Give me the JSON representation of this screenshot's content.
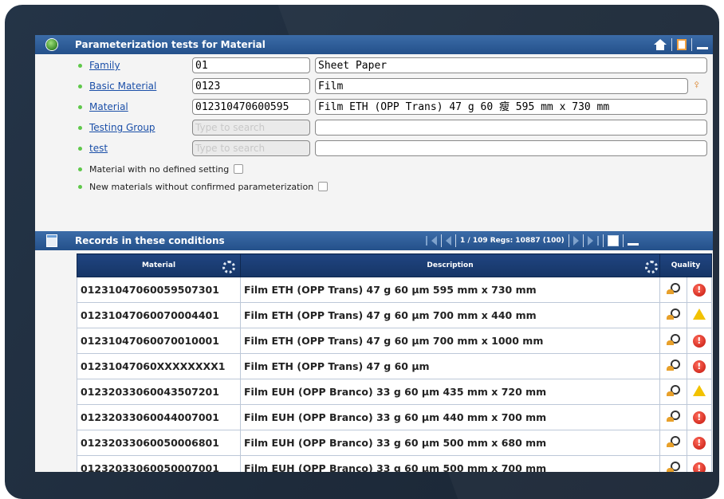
{
  "panel": {
    "title": "Parameterization tests for Material"
  },
  "form": {
    "family": {
      "label": "Family",
      "code": "01",
      "desc": "Sheet Paper"
    },
    "basic_material": {
      "label": "Basic Material",
      "code": "0123",
      "desc": "Film"
    },
    "material": {
      "label": "Material",
      "code": "012310470600595",
      "desc": "Film ETH (OPP Trans) 47 g 60 瘦 595 mm x 730 mm"
    },
    "testing_group": {
      "label": "Testing Group",
      "placeholder": "Type to search",
      "desc": ""
    },
    "test": {
      "label": "test",
      "placeholder": "Type to search",
      "desc": ""
    },
    "no_setting_label": "Material with no defined setting",
    "new_materials_label": "New materials without confirmed parameterization"
  },
  "records": {
    "title": "Records in these conditions",
    "pager_text": "1 / 109  Regs: 10887  (100)",
    "columns": {
      "material": "Material",
      "description": "Description",
      "quality": "Quality"
    },
    "rows": [
      {
        "material": "01231047060059507301",
        "description": "Film ETH (OPP Trans) 47 g 60 μm 595 mm x 730 mm",
        "status": "error"
      },
      {
        "material": "01231047060070004401",
        "description": "Film ETH (OPP Trans) 47 g 60 μm 700 mm x 440 mm",
        "status": "warning"
      },
      {
        "material": "01231047060070010001",
        "description": "Film ETH (OPP Trans) 47 g 60 μm 700 mm x 1000 mm",
        "status": "error"
      },
      {
        "material": "01231047060XXXXXXXX1",
        "description": "Film ETH (OPP Trans) 47 g 60 μm",
        "status": "error"
      },
      {
        "material": "01232033060043507201",
        "description": "Film EUH (OPP Branco) 33 g 60 μm 435 mm x 720 mm",
        "status": "warning"
      },
      {
        "material": "01232033060044007001",
        "description": "Film EUH (OPP Branco) 33 g 60 μm 440 mm x 700 mm",
        "status": "error"
      },
      {
        "material": "01232033060050006801",
        "description": "Film EUH (OPP Branco) 33 g 60 μm 500 mm x 680 mm",
        "status": "error"
      },
      {
        "material": "01232033060050007001",
        "description": "Film EUH (OPP Branco) 33 g 60 μm 500 mm x 700 mm",
        "status": "error"
      }
    ]
  },
  "colors": {
    "header_blue": "#2b5b96",
    "error_red": "#d0201a",
    "warning_yellow": "#f2c200",
    "bullet_green": "#5fc84a"
  }
}
